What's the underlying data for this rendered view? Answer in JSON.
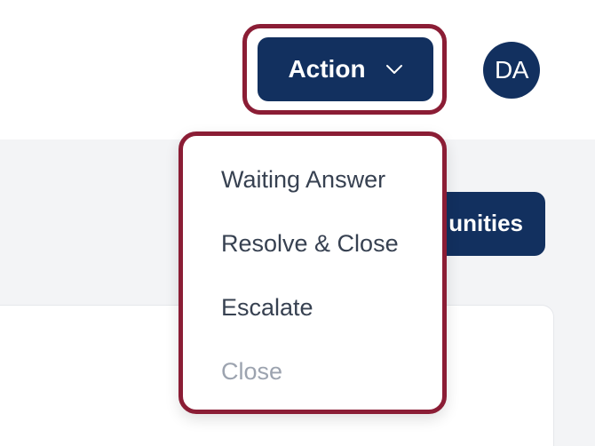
{
  "header": {
    "action_button_label": "Action",
    "avatar_initials": "DA"
  },
  "background": {
    "button_label_partial": "unities"
  },
  "action_menu": {
    "items": [
      {
        "label": "Waiting Answer",
        "disabled": false
      },
      {
        "label": "Resolve & Close",
        "disabled": false
      },
      {
        "label": "Escalate",
        "disabled": false
      },
      {
        "label": "Close",
        "disabled": true
      }
    ]
  },
  "colors": {
    "primary": "#12305f",
    "highlight_outline": "#8b1d35",
    "text": "#374151",
    "disabled_text": "#9ca3af"
  }
}
